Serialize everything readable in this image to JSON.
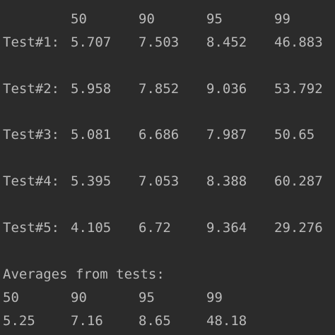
{
  "console": {
    "header_percentiles": [
      "50",
      "90",
      "95",
      "99"
    ],
    "tests": [
      {
        "label": "Test#1:",
        "values": [
          "5.707",
          "7.503",
          "8.452",
          "46.883"
        ]
      },
      {
        "label": "Test#2:",
        "values": [
          "5.958",
          "7.852",
          "9.036",
          "53.792"
        ]
      },
      {
        "label": "Test#3:",
        "values": [
          "5.081",
          "6.686",
          "7.987",
          "50.65"
        ]
      },
      {
        "label": "Test#4:",
        "values": [
          "5.395",
          "7.053",
          "8.388",
          "60.287"
        ]
      },
      {
        "label": "Test#5:",
        "values": [
          "4.105",
          "6.72",
          "9.364",
          "29.276"
        ]
      }
    ],
    "averages_title": "Averages from tests:",
    "averages_percentiles": [
      "50",
      "90",
      "95",
      "99"
    ],
    "averages_values": [
      "5.25",
      "7.16",
      "8.65",
      "48.18"
    ]
  }
}
